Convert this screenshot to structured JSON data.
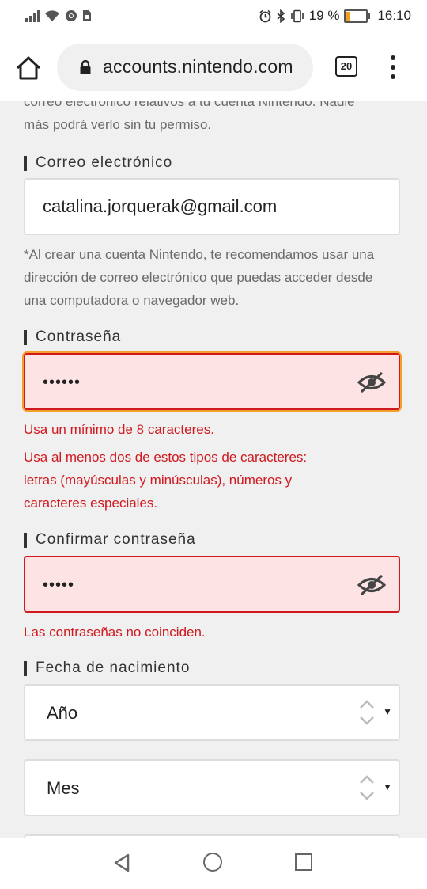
{
  "status_bar": {
    "battery_text": "19 %",
    "battery_level": 0.19,
    "battery_color": "#f0a020",
    "time": "16:10",
    "icons": [
      "signal-icon",
      "wifi-icon",
      "chrome-icon",
      "sim-icon",
      "alarm-icon",
      "bluetooth-icon",
      "vibrate-icon",
      "battery-icon"
    ]
  },
  "browser": {
    "url": "accounts.nintendo.com",
    "tab_count": "20"
  },
  "form": {
    "intro_lines": [
      "correo electrónico relativos a tu cuenta Nintendo. Nadie",
      "más podrá verlo sin tu permiso."
    ],
    "email_label": "Correo electrónico",
    "email_value": "catalina.jorquerak@gmail.com",
    "email_note_lines": [
      "*Al crear una cuenta Nintendo, te recomendamos usar una",
      "dirección de correo electrónico que puedas acceder desde",
      "una computadora o navegador web."
    ],
    "password_label": "Contraseña",
    "password_value": "••••••",
    "password_error_1": "Usa un mínimo de 8 caracteres.",
    "password_error_2_lines": [
      "Usa al menos dos de estos tipos de caracteres:",
      "letras (mayúsculas y minúsculas), números y",
      "caracteres especiales."
    ],
    "confirm_label": "Confirmar contraseña",
    "confirm_value": "•••••",
    "confirm_error": "Las contraseñas no coinciden.",
    "birth_label": "Fecha de nacimiento",
    "year_value": "Año",
    "month_value": "Mes",
    "error_color": "#d0191f",
    "error_bg": "#fde3e3",
    "focus_color": "#f2a02b"
  }
}
